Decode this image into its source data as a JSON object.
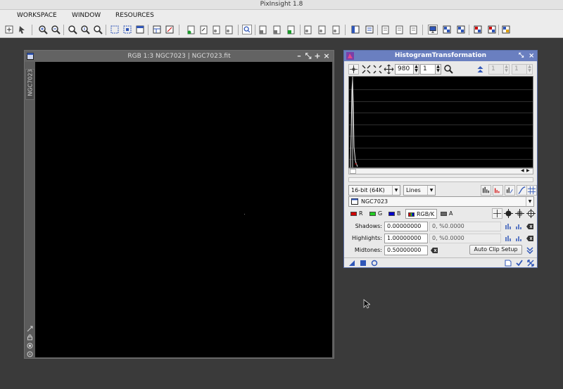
{
  "app": {
    "title": "PixInsight 1.8"
  },
  "menu": [
    "WORKSPACE",
    "WINDOW",
    "RESOURCES"
  ],
  "image_window": {
    "title": "RGB 1:3 NGC7023 | NGC7023.fit",
    "side_tab": "NGC7023",
    "controls": [
      "–",
      "⤡",
      "+",
      "×"
    ]
  },
  "histogram": {
    "title": "HistogramTransformation",
    "title_controls": [
      "⤡",
      "×"
    ],
    "zoom_x": "980",
    "zoom_y": "1",
    "range_a": "1",
    "range_b": "1",
    "resolution": "16-bit (64K)",
    "graph_style": "Lines",
    "view": "NGC7023",
    "channels": [
      {
        "label": "R",
        "color": "#d00000"
      },
      {
        "label": "G",
        "color": "#22cc22"
      },
      {
        "label": "B",
        "color": "#0000cc"
      },
      {
        "label": "RGB/K",
        "color": "#555555"
      },
      {
        "label": "A",
        "color": "#666666"
      }
    ],
    "shadows_label": "Shadows:",
    "shadows_value": "0.00000000",
    "shadows_clip": "0, %0.0000",
    "highlights_label": "Highlights:",
    "highlights_value": "1.00000000",
    "highlights_clip": "0, %0.0000",
    "midtones_label": "Midtones:",
    "midtones_value": "0.50000000",
    "auto_clip_label": "Auto Clip Setup"
  },
  "colors": {
    "workspace": "#3a3a3a",
    "panel_title": "#6a7fc0",
    "toolbar_icon": "#2f56b8"
  }
}
